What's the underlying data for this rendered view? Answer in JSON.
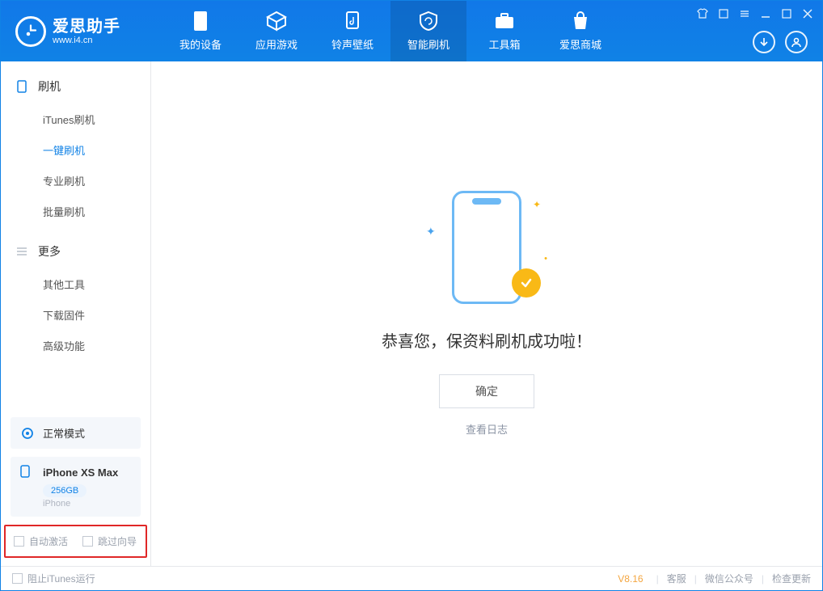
{
  "brand": {
    "name": "爱思助手",
    "url": "www.i4.cn"
  },
  "nav": {
    "tabs": [
      {
        "label": "我的设备",
        "icon": "phone-icon"
      },
      {
        "label": "应用游戏",
        "icon": "cube-icon"
      },
      {
        "label": "铃声壁纸",
        "icon": "music-note-icon"
      },
      {
        "label": "智能刷机",
        "icon": "shield-refresh-icon",
        "active": true
      },
      {
        "label": "工具箱",
        "icon": "toolbox-icon"
      },
      {
        "label": "爱思商城",
        "icon": "shopping-bag-icon"
      }
    ]
  },
  "sidebar": {
    "sections": [
      {
        "title": "刷机",
        "icon": "device-icon",
        "items": [
          {
            "label": "iTunes刷机"
          },
          {
            "label": "一键刷机",
            "active": true
          },
          {
            "label": "专业刷机"
          },
          {
            "label": "批量刷机"
          }
        ]
      },
      {
        "title": "更多",
        "icon": "list-icon",
        "items": [
          {
            "label": "其他工具"
          },
          {
            "label": "下载固件"
          },
          {
            "label": "高级功能"
          }
        ]
      }
    ],
    "mode_card": {
      "label": "正常模式",
      "icon": "cycle-icon"
    },
    "device": {
      "name": "iPhone XS Max",
      "capacity": "256GB",
      "type": "iPhone"
    },
    "options": {
      "auto_activate": "自动激活",
      "skip_guide": "跳过向导"
    }
  },
  "main": {
    "title": "恭喜您，保资料刷机成功啦！",
    "ok_label": "确定",
    "log_link": "查看日志"
  },
  "footer": {
    "block_itunes": "阻止iTunes运行",
    "version": "V8.16",
    "links": {
      "support": "客服",
      "wechat": "微信公众号",
      "update": "检查更新"
    }
  }
}
